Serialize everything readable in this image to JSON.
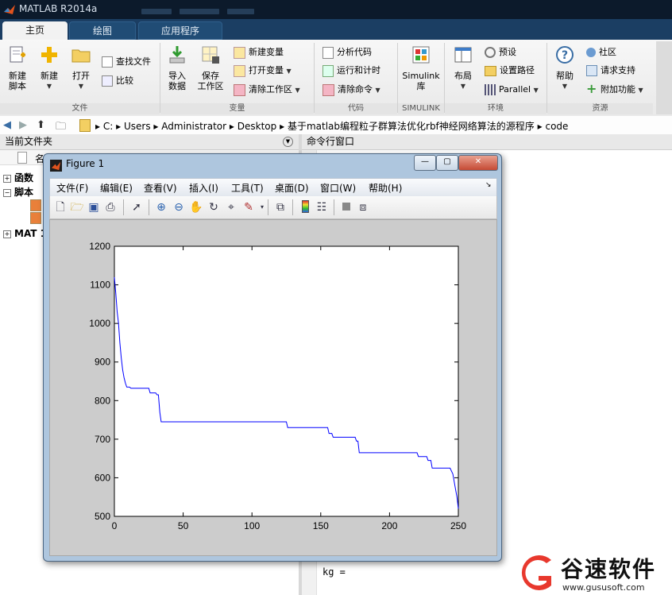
{
  "window": {
    "title": "MATLAB R2014a"
  },
  "tabs": [
    {
      "label": "主页",
      "active": true
    },
    {
      "label": "绘图",
      "active": false
    },
    {
      "label": "应用程序",
      "active": false
    }
  ],
  "ribbon": {
    "file": {
      "label": "文件",
      "new_script": [
        "新建",
        "脚本"
      ],
      "new": "新建",
      "open": "打开",
      "find_files": "查找文件",
      "compare": "比较"
    },
    "variable": {
      "label": "变量",
      "import_data": [
        "导入",
        "数据"
      ],
      "save_workspace": [
        "保存",
        "工作区"
      ],
      "new_variable": "新建变量",
      "open_variable": "打开变量",
      "clear_workspace": "清除工作区"
    },
    "code": {
      "label": "代码",
      "analyze_code": "分析代码",
      "run_and_time": "运行和计时",
      "clear_commands": "清除命令"
    },
    "simulink": {
      "label": "SIMULINK",
      "library": [
        "Simulink",
        "库"
      ]
    },
    "environment": {
      "label": "环境",
      "layout": "布局",
      "preferences": "预设",
      "set_path": "设置路径",
      "parallel": "Parallel"
    },
    "resources": {
      "label": "资源",
      "help": "帮助",
      "community": "社区",
      "request_support": "请求支持",
      "add_ons": "附加功能"
    }
  },
  "address": {
    "separator": "▸",
    "crumbs": [
      "C:",
      "Users",
      "Administrator",
      "Desktop",
      "基于matlab编程粒子群算法优化rbf神经网络算法的源程序",
      "code"
    ]
  },
  "left_panel": {
    "title": "当前文件夹",
    "col_fragment": "名",
    "tree": [
      {
        "label": "函数",
        "expanded": false
      },
      {
        "label": "脚本",
        "expanded": true
      },
      {
        "label": "MAT",
        "expanded": false
      }
    ],
    "mat_suffix": "1"
  },
  "command_window": {
    "title": "命令行窗口",
    "output_line": "kg ="
  },
  "figure": {
    "title": "Figure 1",
    "menus": [
      "文件(F)",
      "编辑(E)",
      "查看(V)",
      "插入(I)",
      "工具(T)",
      "桌面(D)",
      "窗口(W)",
      "帮助(H)"
    ],
    "toolbar_icons": [
      "new-figure-icon",
      "open-icon",
      "save-icon",
      "print-icon",
      "pointer-icon",
      "zoom-in-icon",
      "zoom-out-icon",
      "pan-icon",
      "rotate-icon",
      "data-cursor-icon",
      "brush-icon",
      "link-icon",
      "colorbar-icon",
      "legend-icon",
      "hide-tools-icon",
      "show-tools-icon"
    ],
    "win_buttons": {
      "minimize": "—",
      "maximize": "▢",
      "close": "✕"
    }
  },
  "chart_data": {
    "type": "line",
    "xlim": [
      0,
      250
    ],
    "ylim": [
      500,
      1200
    ],
    "xticks": [
      0,
      50,
      100,
      150,
      200,
      250
    ],
    "yticks": [
      500,
      600,
      700,
      800,
      900,
      1000,
      1100,
      1200
    ],
    "color": "#0000ff",
    "grid": false,
    "series": [
      {
        "points": [
          [
            0,
            1120
          ],
          [
            1,
            1080
          ],
          [
            2,
            1030
          ],
          [
            3,
            1000
          ],
          [
            4,
            950
          ],
          [
            5,
            910
          ],
          [
            6,
            880
          ],
          [
            7,
            860
          ],
          [
            8,
            845
          ],
          [
            9,
            835
          ],
          [
            11,
            835
          ],
          [
            12,
            832
          ],
          [
            25,
            832
          ],
          [
            26,
            820
          ],
          [
            30,
            820
          ],
          [
            31,
            815
          ],
          [
            32,
            815
          ],
          [
            33,
            770
          ],
          [
            34,
            745
          ],
          [
            125,
            745
          ],
          [
            126,
            730
          ],
          [
            155,
            730
          ],
          [
            156,
            715
          ],
          [
            158,
            715
          ],
          [
            159,
            705
          ],
          [
            175,
            705
          ],
          [
            176,
            695
          ],
          [
            177,
            695
          ],
          [
            178,
            665
          ],
          [
            220,
            665
          ],
          [
            221,
            655
          ],
          [
            227,
            655
          ],
          [
            228,
            645
          ],
          [
            230,
            645
          ],
          [
            231,
            625
          ],
          [
            244,
            625
          ],
          [
            246,
            610
          ],
          [
            247,
            590
          ],
          [
            248,
            570
          ],
          [
            249,
            550
          ],
          [
            250,
            520
          ]
        ]
      }
    ]
  },
  "watermark": {
    "brand": "谷速软件",
    "url": "www.gususoft.com",
    "accent": "#e8382d"
  }
}
